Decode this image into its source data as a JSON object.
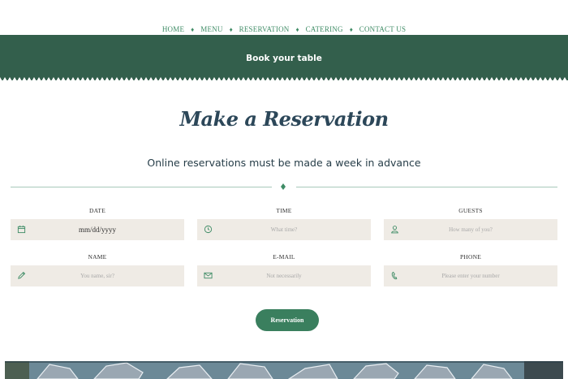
{
  "nav": {
    "items": [
      {
        "label": "HOME"
      },
      {
        "label": "MENU"
      },
      {
        "label": "RESERVATION"
      },
      {
        "label": "CATERING"
      },
      {
        "label": "CONTACT US"
      }
    ],
    "separator": "♦"
  },
  "banner": {
    "title": "Book your table"
  },
  "heading": {
    "title": "Make a Reservation",
    "subtitle": "Online reservations must be made a week in advance"
  },
  "form": {
    "date": {
      "label": "DATE",
      "value": "mm/dd/yyyy",
      "icon": "calendar-icon"
    },
    "time": {
      "label": "TIME",
      "placeholder": "What time?",
      "icon": "clock-icon"
    },
    "guests": {
      "label": "GUESTS",
      "placeholder": "How many of you?",
      "icon": "user-icon"
    },
    "name": {
      "label": "NAME",
      "placeholder": "You name, sir?",
      "icon": "pencil-icon"
    },
    "email": {
      "label": "E-MAIL",
      "placeholder": "Not necessarily",
      "icon": "envelope-icon"
    },
    "phone": {
      "label": "PHONE",
      "placeholder": "Please enter your number",
      "icon": "phone-icon"
    },
    "submit_label": "Reservation"
  },
  "colors": {
    "accent": "#3f8c66",
    "banner": "#335f4c",
    "title": "#2c4759",
    "input_bg": "#efebe5"
  }
}
